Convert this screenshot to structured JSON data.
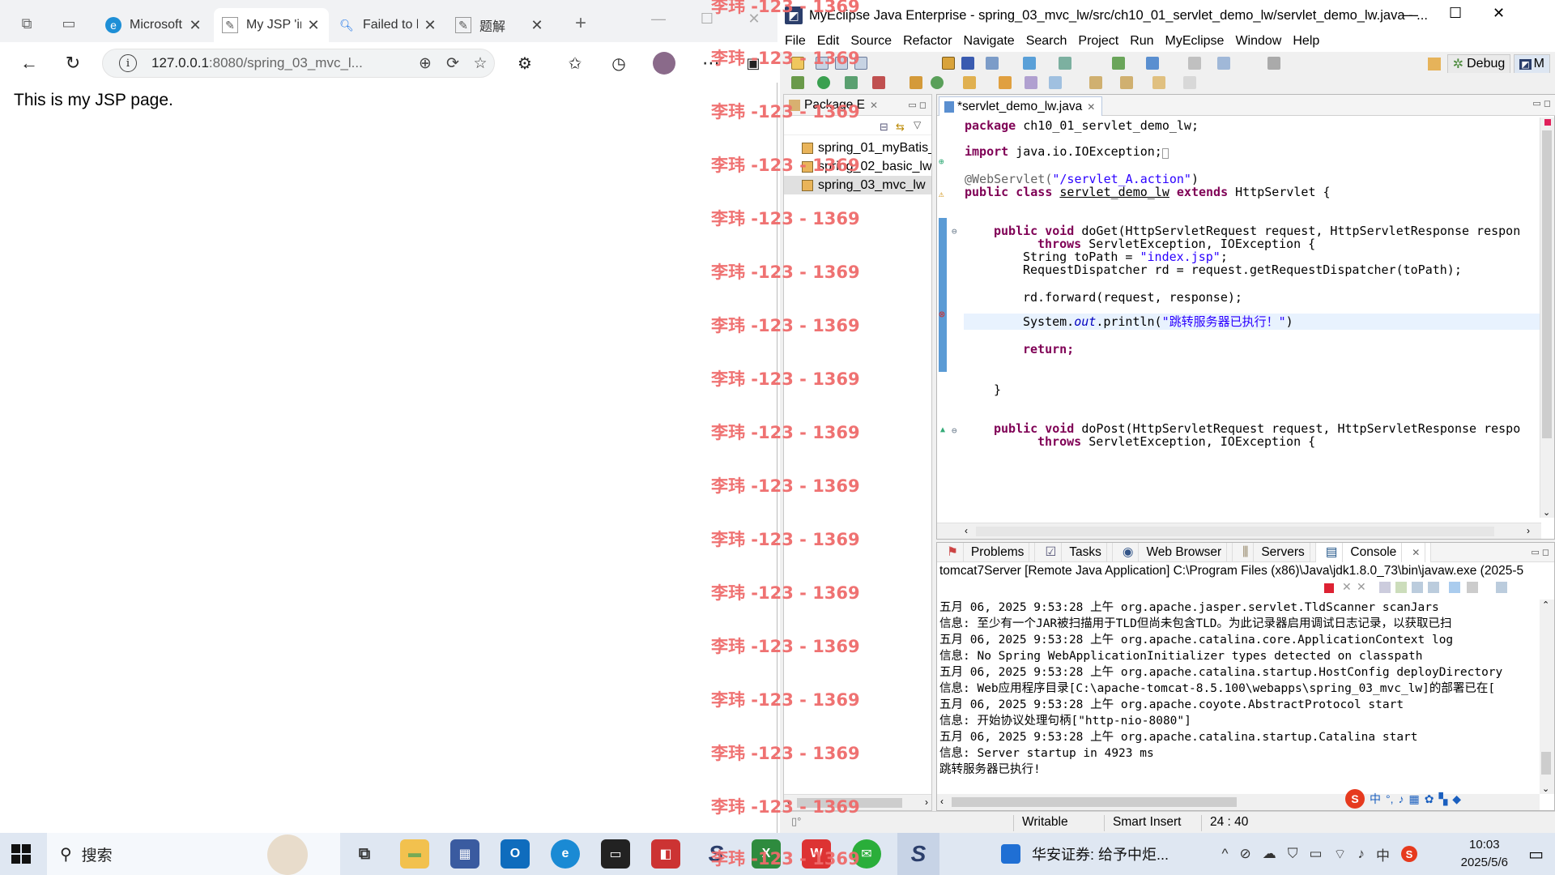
{
  "browser": {
    "tabs": [
      {
        "label": "Microsoft",
        "icon": "edge-icon"
      },
      {
        "label": "My JSP 'in",
        "icon": "page-icon",
        "active": true
      },
      {
        "label": "Failed to l",
        "icon": "search-icon"
      },
      {
        "label": "题解",
        "icon": "page-icon"
      }
    ],
    "url_host": "127.0.0.1",
    "url_rest": ":8080/spring_03_mvc_l...",
    "page_text": "This is my JSP page."
  },
  "watermark": {
    "text": "李玮 -123 - 1369",
    "color": "#ef6b6b"
  },
  "ide": {
    "title": "MyEclipse Java Enterprise - spring_03_mvc_lw/src/ch10_01_servlet_demo_lw/servlet_demo_lw.java - ...",
    "menu": [
      "File",
      "Edit",
      "Source",
      "Refactor",
      "Navigate",
      "Search",
      "Project",
      "Run",
      "MyEclipse",
      "Window",
      "Help"
    ],
    "perspective": "Debug",
    "perspective2": "M",
    "package_explorer": {
      "title": "Package E",
      "projects": [
        "spring_01_myBatis_",
        "spring_02_basic_lw",
        "spring_03_mvc_lw"
      ]
    },
    "editor_tab": "*servlet_demo_lw.java",
    "code": {
      "l1a": "package",
      "l1b": " ch10_01_servlet_demo_lw;",
      "l2a": "import",
      "l2b": " java.io.IOException;",
      "l3a": "@WebServlet(",
      "l3b": "\"/servlet_A.action\"",
      "l3c": ")",
      "l4a": "public class",
      "l4b": "servlet_demo_lw",
      "l4c": "extends",
      "l4d": " HttpServlet {",
      "l5a": "public void",
      "l5b": " doGet(HttpServletRequest request, HttpServletResponse respon",
      "l6a": "throws",
      "l6b": " ServletException, IOException {",
      "l7a": "String toPath = ",
      "l7b": "\"index.jsp\"",
      "l7c": ";",
      "l8": "RequestDispatcher rd = request.getRequestDispatcher(toPath);",
      "l9": "rd.forward(request, response);",
      "l10a": "System.",
      "l10b": "out",
      "l10c": ".println(",
      "l10d": "\"跳转服务器已执行！\"",
      "l10e": ")",
      "l11": "return;",
      "l12": "}",
      "l13a": "public void",
      "l13b": " doPost(HttpServletRequest request, HttpServletResponse respo",
      "l14a": "throws",
      "l14b": " ServletException, IOException {"
    },
    "console": {
      "tabs": [
        "Problems",
        "Tasks",
        "Web Browser",
        "Servers",
        "Console"
      ],
      "description": "tomcat7Server [Remote Java Application] C:\\Program Files (x86)\\Java\\jdk1.8.0_73\\bin\\javaw.exe (2025-5",
      "lines": [
        "五月 06, 2025 9:53:28 上午 org.apache.jasper.servlet.TldScanner scanJars",
        "信息: 至少有一个JAR被扫描用于TLD但尚未包含TLD。为此记录器启用调试日志记录，以获取已扫",
        "五月 06, 2025 9:53:28 上午 org.apache.catalina.core.ApplicationContext log",
        "信息: No Spring WebApplicationInitializer types detected on classpath",
        "五月 06, 2025 9:53:28 上午 org.apache.catalina.startup.HostConfig deployDirectory",
        "信息: Web应用程序目录[C:\\apache-tomcat-8.5.100\\webapps\\spring_03_mvc_lw]的部署已在[",
        "五月 06, 2025 9:53:28 上午 org.apache.coyote.AbstractProtocol start",
        "信息: 开始协议处理句柄[\"http-nio-8080\"]",
        "五月 06, 2025 9:53:28 上午 org.apache.catalina.startup.Catalina start",
        "信息: Server startup in 4923 ms",
        "跳转服务器已执行!"
      ]
    },
    "status": {
      "writable": "Writable",
      "insert": "Smart Insert",
      "position": "24 : 40"
    }
  },
  "taskbar": {
    "search": "搜索",
    "news": "华安证券: 给予中炬...",
    "ime": "中",
    "time": "10:03",
    "date": "2025/5/6"
  }
}
